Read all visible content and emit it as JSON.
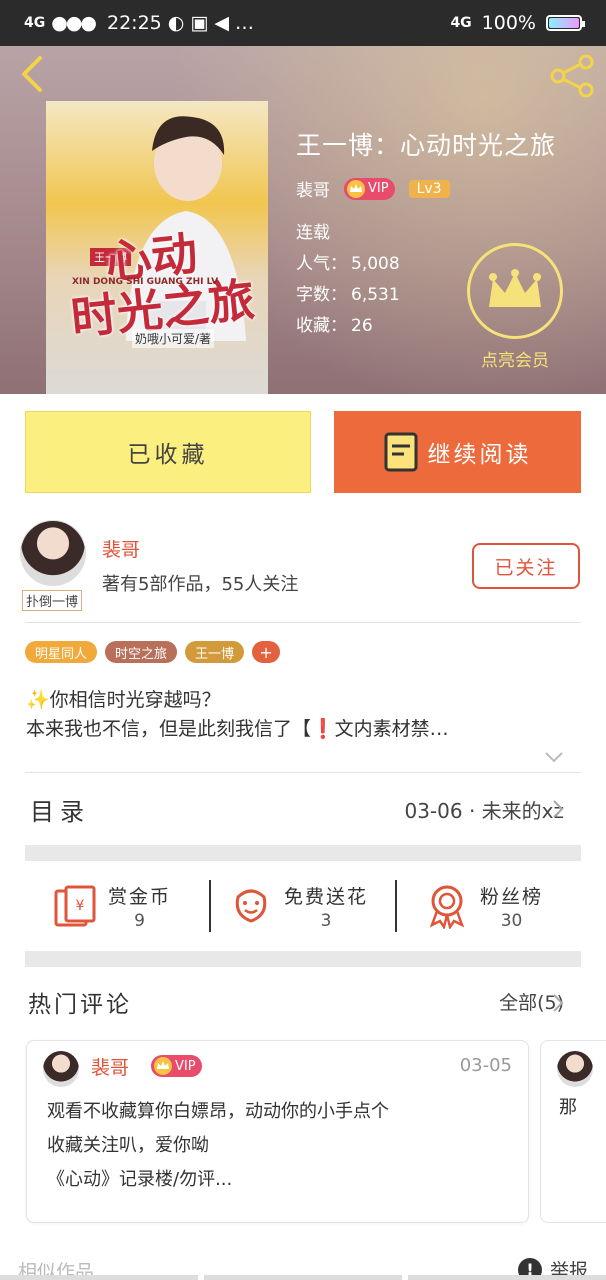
{
  "status_bar": {
    "network_left": "4G",
    "time": "22:25",
    "network_right": "4G",
    "battery": "100%"
  },
  "book": {
    "title": "王一博：心动时光之旅",
    "author": "裴哥",
    "vip_label": "VIP",
    "level": "Lv3",
    "status": "连载",
    "popularity_label": "人气：",
    "popularity": "5,008",
    "words_label": "字数：",
    "words": "6,531",
    "collections_label": "收藏：",
    "collections": "26",
    "cover": {
      "tag": "王一博",
      "title_line1": "心动",
      "title_line2": "时光之旅",
      "pinyin": "XIN DONG SHI GUANG ZHI LV",
      "author": "奶哦小可爱/著"
    }
  },
  "vip_promo": {
    "label": "点亮会员"
  },
  "actions": {
    "collected": "已收藏",
    "continue_read": "继续阅读"
  },
  "author": {
    "name": "裴哥",
    "stats": "著有5部作品，55人关注",
    "avatar_tag": "扑倒一博",
    "follow_label": "已关注"
  },
  "tags": [
    {
      "label": "明星同人",
      "color": "#f0a93a"
    },
    {
      "label": "时空之旅",
      "color": "#b8705a"
    },
    {
      "label": "王一博",
      "color": "#d39a3c"
    }
  ],
  "tags_add": "+",
  "intro": {
    "line1": "✨你相信时光穿越吗？",
    "line2": "本来我也不信，但是此刻我信了【❗文内素材禁…"
  },
  "catalog": {
    "title": "目录",
    "latest": "03-06 · 未来的xz"
  },
  "stats": [
    {
      "label": "赏金币",
      "value": "9",
      "icon": "red-envelope-icon"
    },
    {
      "label": "免费送花",
      "value": "3",
      "icon": "flower-icon"
    },
    {
      "label": "粉丝榜",
      "value": "30",
      "icon": "medal-icon"
    }
  ],
  "hot_comments": {
    "title": "热门评论",
    "all_label": "全部(5)",
    "items": [
      {
        "name": "裴哥",
        "vip": "VIP",
        "date": "03-05",
        "text_line1": "观看不收藏算你白嫖昂，动动你的小手点个",
        "text_line2": "收藏关注叭，爱你呦",
        "text_line3": "《心动》记录楼/勿评..."
      },
      {
        "text": "那"
      }
    ]
  },
  "footer": {
    "similar": "相似作品",
    "report": "举报"
  },
  "colors": {
    "accent_orange": "#ec6a3b",
    "collected_yellow": "#fbf07f",
    "author_red": "#e0543a",
    "vip_gold": "#f6e27a"
  }
}
